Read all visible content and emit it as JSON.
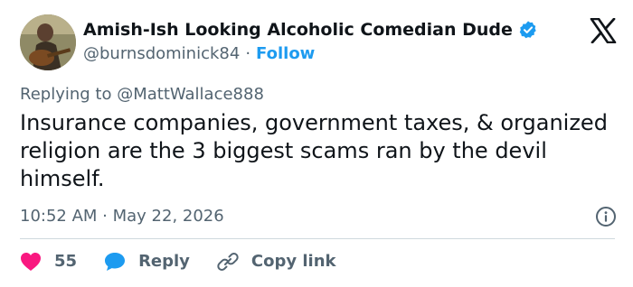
{
  "author": {
    "display_name": "Amish-Ish Looking Alcoholic Comedian Dude",
    "handle": "@burnsdominick84",
    "separator": "·",
    "follow_label": "Follow"
  },
  "reply_context": "Replying to @MattWallace888",
  "tweet": {
    "text": "Insurance companies, government taxes, & organized religion are the 3 biggest scams ran by the devil himself.",
    "timestamp": "10:52 AM · May 22, 2026"
  },
  "actions": {
    "like_count": "55",
    "reply_label": "Reply",
    "copy_link_label": "Copy link"
  },
  "icons": {
    "verified": "verified-badge-icon",
    "logo": "x-logo-icon",
    "info": "info-icon",
    "like": "heart-icon",
    "reply": "speech-bubble-icon",
    "copy_link": "link-icon"
  },
  "colors": {
    "accent": "#1d9bf0",
    "like": "#f91880",
    "text": "#0f1419",
    "muted": "#536471"
  }
}
